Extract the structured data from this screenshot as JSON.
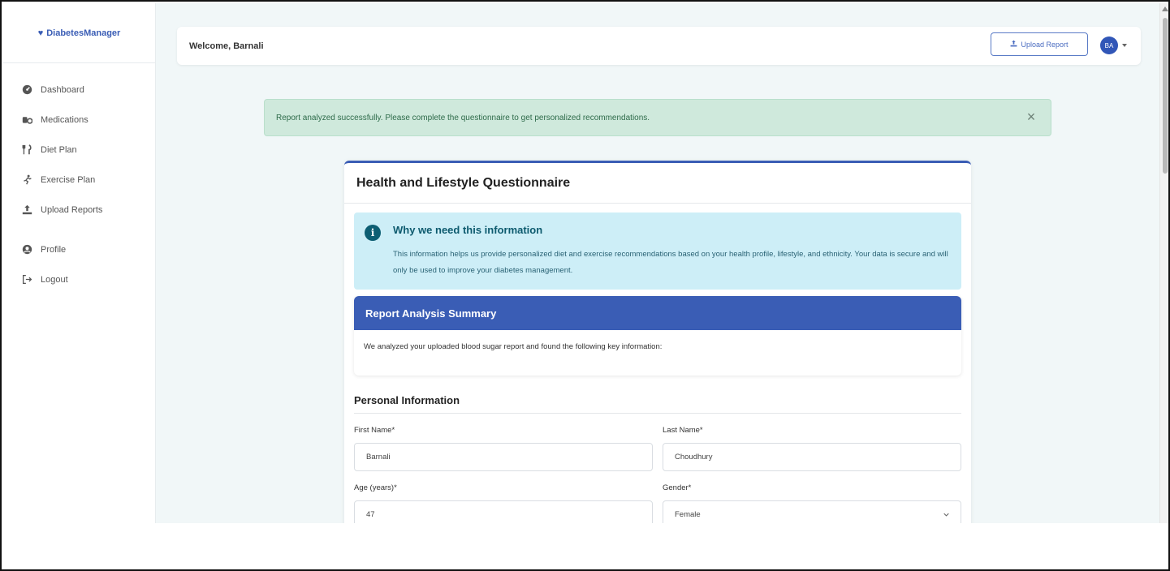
{
  "brand": {
    "name": "DiabetesManager",
    "icon": "heart-pulse-icon"
  },
  "sidebar": {
    "items": [
      {
        "label": "Dashboard",
        "icon": "dashboard-icon"
      },
      {
        "label": "Medications",
        "icon": "pills-icon"
      },
      {
        "label": "Diet Plan",
        "icon": "utensils-icon"
      },
      {
        "label": "Exercise Plan",
        "icon": "running-icon"
      },
      {
        "label": "Upload Reports",
        "icon": "upload-icon"
      },
      {
        "label": "Profile",
        "icon": "user-circle-icon"
      },
      {
        "label": "Logout",
        "icon": "logout-icon"
      }
    ]
  },
  "header": {
    "welcome": "Welcome, Barnali",
    "upload_button": "Upload Report",
    "avatar_initials": "BA"
  },
  "alert": {
    "message": "Report analyzed successfully. Please complete the questionnaire to get personalized recommendations.",
    "close": "×"
  },
  "questionnaire": {
    "title": "Health and Lifestyle Questionnaire",
    "info": {
      "title": "Why we need this information",
      "text": "This information helps us provide personalized diet and exercise recommendations based on your health profile, lifestyle, and ethnicity. Your data is secure and will only be used to improve your diabetes management."
    },
    "summary": {
      "title": "Report Analysis Summary",
      "text": "We analyzed your uploaded blood sugar report and found the following key information:"
    },
    "personal": {
      "title": "Personal Information",
      "first_name_label": "First Name*",
      "first_name_value": "Barnali",
      "last_name_label": "Last Name*",
      "last_name_value": "Choudhury",
      "age_label": "Age (years)*",
      "age_value": "47",
      "gender_label": "Gender*",
      "gender_value": "Female"
    }
  },
  "colors": {
    "primary": "#3a5db5",
    "success_bg": "#cfe9dc",
    "info_bg": "#cdeef7",
    "page_bg": "#f1f7f8"
  }
}
